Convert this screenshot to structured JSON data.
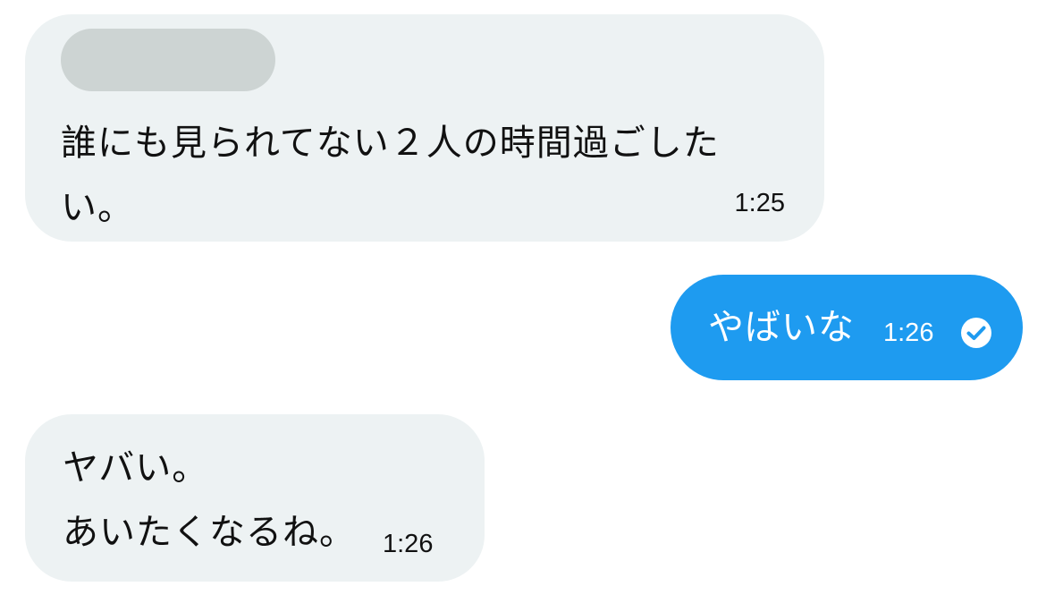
{
  "messages": [
    {
      "direction": "incoming",
      "sender_redacted": true,
      "text": "誰にも見られてない２人の時間過ごしたい。",
      "time": "1:25"
    },
    {
      "direction": "outgoing",
      "text": "やばいな",
      "time": "1:26",
      "status_icon": "read-check-icon"
    },
    {
      "direction": "incoming",
      "text": "ヤバい。\nあいたくなるね。",
      "time": "1:26"
    }
  ],
  "colors": {
    "incoming_bubble": "#edf2f3",
    "outgoing_bubble": "#1e9bf0",
    "redaction": "#cdd4d3"
  }
}
